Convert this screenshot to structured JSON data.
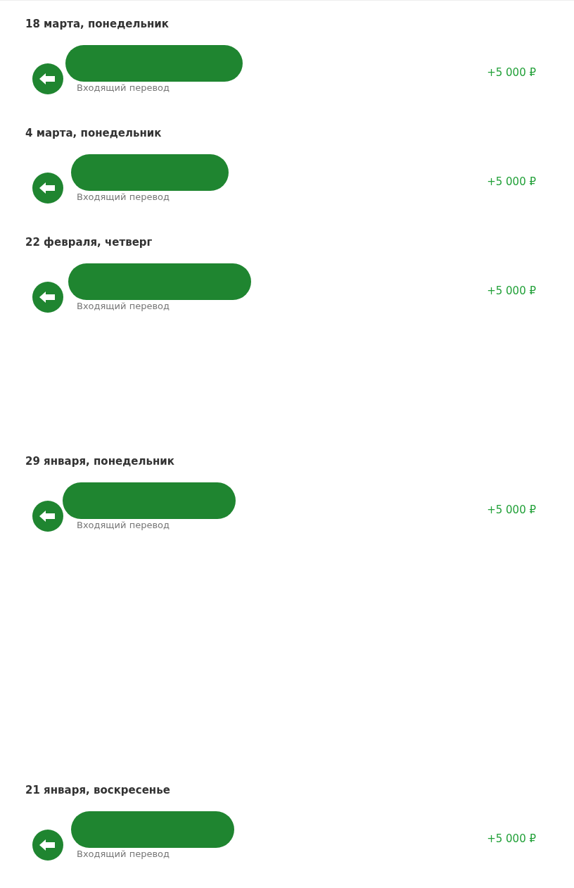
{
  "groups": [
    {
      "date": "18 марта, понедельник",
      "operations": [
        {
          "subtitle": "Входящий перевод",
          "amount": "+5 000 ₽"
        }
      ]
    },
    {
      "date": "4 марта, понедельник",
      "operations": [
        {
          "subtitle": "Входящий перевод",
          "amount": "+5 000 ₽"
        }
      ]
    },
    {
      "date": "22 февраля, четверг",
      "operations": [
        {
          "subtitle": "Входящий перевод",
          "amount": "+5 000 ₽"
        }
      ]
    },
    {
      "date": "29 января, понедельник",
      "operations": [
        {
          "subtitle": "Входящий перевод",
          "amount": "+5 000 ₽"
        }
      ]
    },
    {
      "date": "21 января, воскресенье",
      "operations": [
        {
          "subtitle": "Входящий перевод",
          "amount": "+5 000 ₽"
        }
      ]
    }
  ]
}
